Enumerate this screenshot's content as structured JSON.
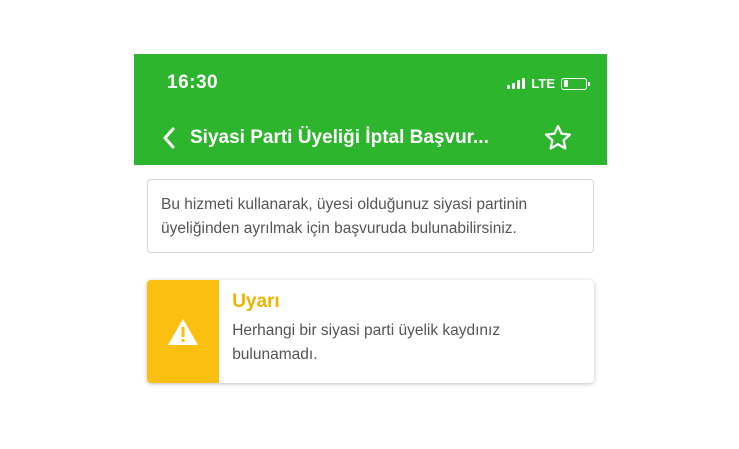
{
  "status_bar": {
    "time": "16:30",
    "network": "LTE",
    "battery_level": 0.2
  },
  "header": {
    "title": "Siyasi Parti Üyeliği İptal Başvur...",
    "back_icon": "chevron-left-icon",
    "favorite_icon": "star-outline-icon",
    "color": "#2db52e"
  },
  "info": {
    "text": "Bu hizmeti kullanarak, üyesi olduğunuz siyasi partinin üyeliğinden ayrılmak için başvuruda bulunabilirsiniz."
  },
  "alert": {
    "icon": "warning-icon",
    "title": "Uyarı",
    "message": "Herhangi bir siyasi parti üyelik kaydınız bulunamadı.",
    "color": "#fbbf10"
  }
}
